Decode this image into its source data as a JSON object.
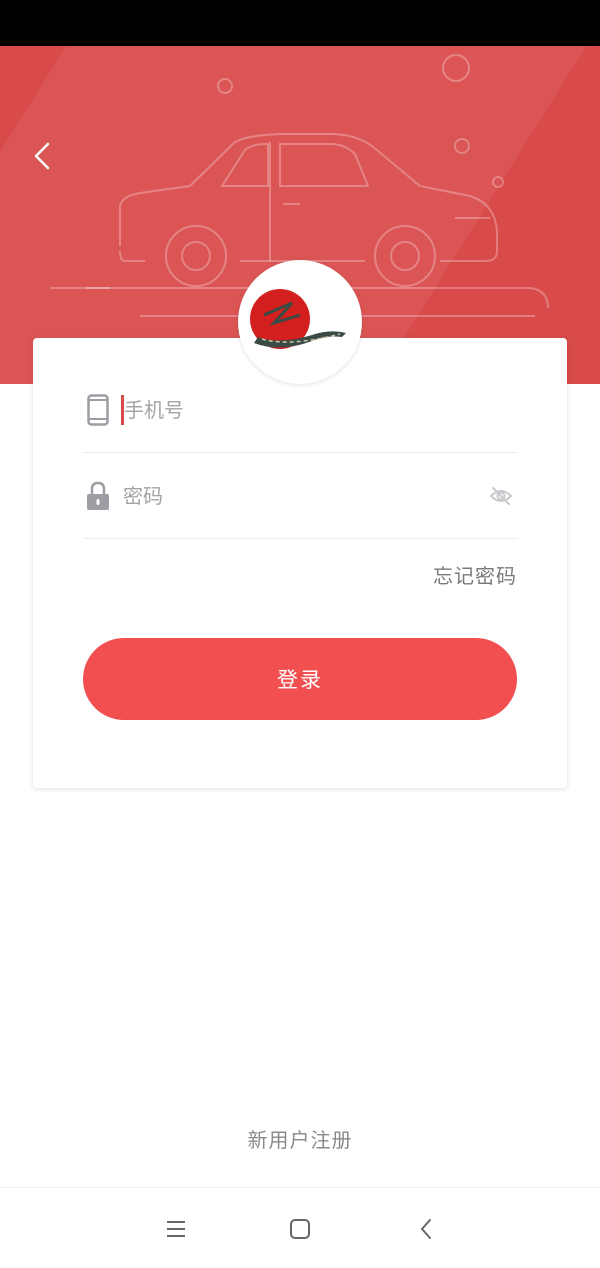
{
  "login_form": {
    "phone_placeholder": "手机号",
    "password_placeholder": "密码",
    "forgot_password": "忘记密码",
    "login_button": "登录"
  },
  "footer": {
    "register_link": "新用户注册"
  },
  "icons": {
    "back": "chevron-left-icon",
    "phone": "phone-icon",
    "lock": "lock-icon",
    "eye": "eye-off-icon",
    "nav_menu": "menu-icon",
    "nav_home": "square-icon",
    "nav_back": "chevron-left-icon"
  },
  "colors": {
    "hero": "#d94b4b",
    "primary_button": "#f25050",
    "caret": "#d94b4b",
    "muted_text": "#8a8a8a"
  }
}
